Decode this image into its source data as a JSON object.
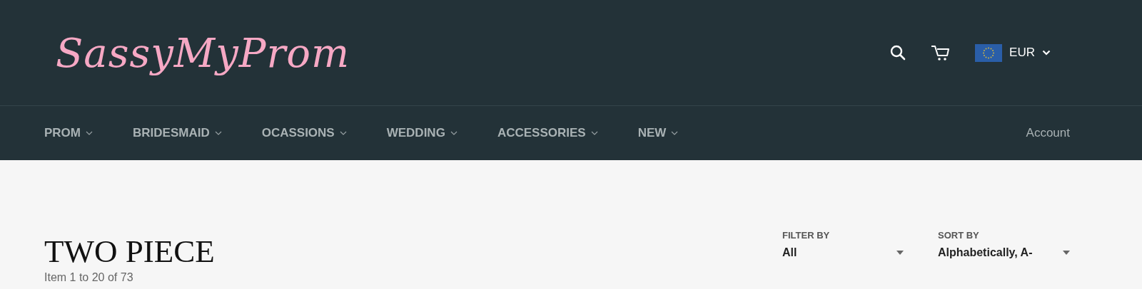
{
  "header": {
    "logo": "SassyMyProm",
    "currency": {
      "code": "EUR"
    }
  },
  "nav": {
    "items": [
      {
        "label": "PROM"
      },
      {
        "label": "BRIDESMAID"
      },
      {
        "label": "OCASSIONS"
      },
      {
        "label": "WEDDING"
      },
      {
        "label": "ACCESSORIES"
      },
      {
        "label": "NEW"
      }
    ],
    "account": "Account"
  },
  "collection": {
    "title": "TWO PIECE",
    "count": "Item 1 to 20 of 73"
  },
  "filters": [
    {
      "label": "FILTER BY",
      "value": "All"
    },
    {
      "label": "SORT BY",
      "value": "Alphabetically, A-"
    }
  ]
}
